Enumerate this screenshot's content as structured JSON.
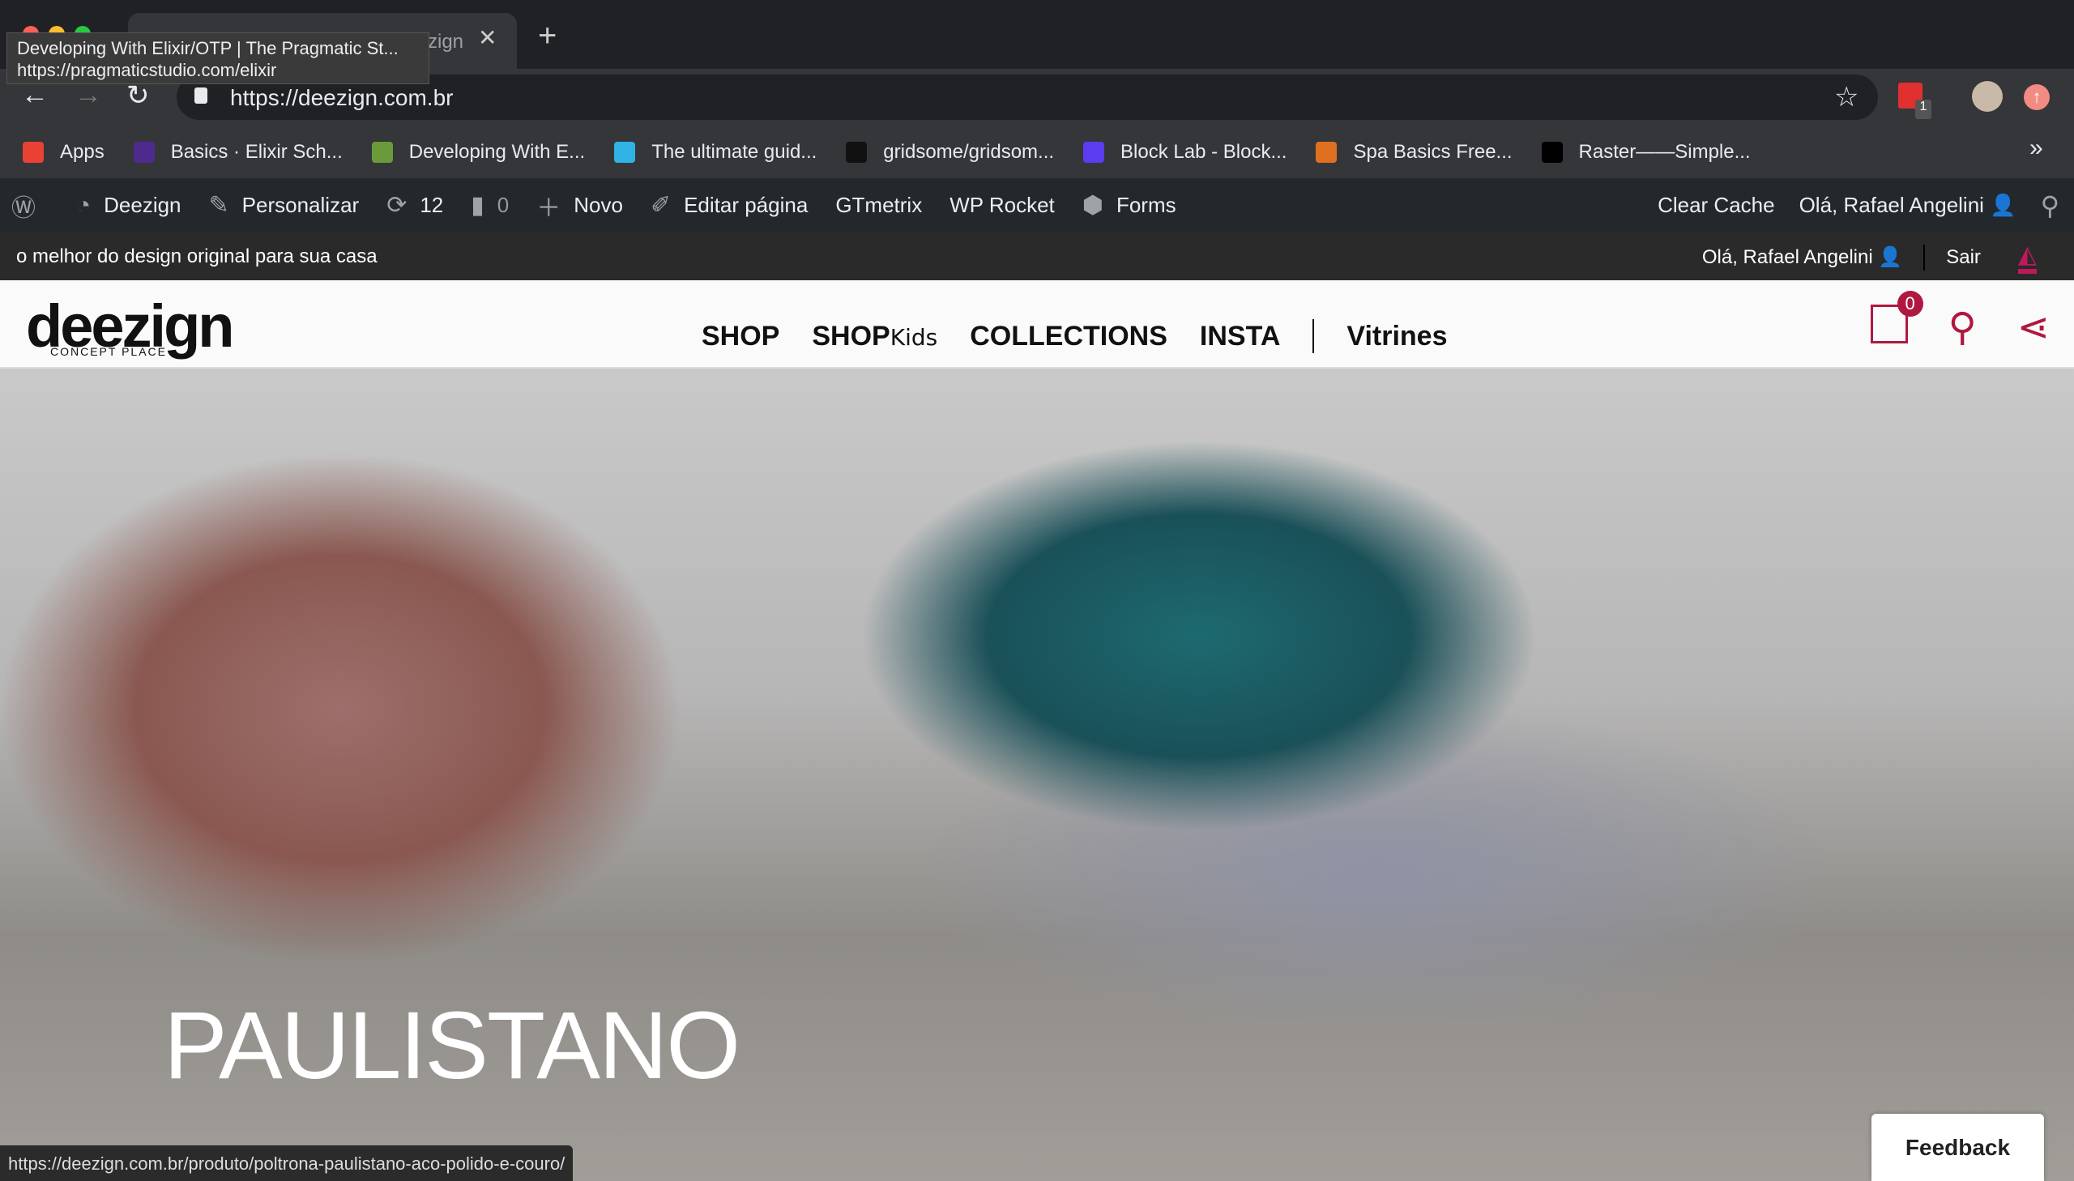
{
  "browser": {
    "tab_title": "Deezign",
    "tab_visible_fragment": "zign",
    "tooltip": {
      "title": "Developing With Elixir/OTP | The Pragmatic St...",
      "url": "https://pragmaticstudio.com/elixir"
    },
    "url": "https://deezign.com.br",
    "extension_badge": "1",
    "bookmarks": [
      {
        "label": "Apps",
        "icon": "apps-grid-icon",
        "color": "#e94235"
      },
      {
        "label": "Basics · Elixir Sch...",
        "icon": "elixir-icon",
        "color": "#4e2a8e"
      },
      {
        "label": "Developing With E...",
        "icon": "s-icon",
        "color": "#6a9a3a"
      },
      {
        "label": "The ultimate guid...",
        "icon": "bear-icon",
        "color": "#2fb3e6"
      },
      {
        "label": "gridsome/gridsom...",
        "icon": "github-icon",
        "color": "#111111"
      },
      {
        "label": "Block Lab - Block...",
        "icon": "blocklab-icon",
        "color": "#5b3cf0"
      },
      {
        "label": "Spa Basics Free...",
        "icon": "lotus-icon",
        "color": "#e07020"
      },
      {
        "label": "Raster——Simple...",
        "icon": "raster-icon",
        "color": "#000000"
      }
    ],
    "more": "»"
  },
  "wp_admin": {
    "site": "Deezign",
    "customize": "Personalizar",
    "updates": "12",
    "comments": "0",
    "new": "Novo",
    "edit": "Editar página",
    "gtmetrix": "GTmetrix",
    "wprocket": "WP Rocket",
    "forms": "Forms",
    "clear_cache": "Clear Cache",
    "greeting": "Olá, Rafael Angelini"
  },
  "topstrip": {
    "tagline": "o melhor do design original para sua casa",
    "greeting": "Olá, Rafael Angelini",
    "logout": "Sair"
  },
  "header": {
    "logo": "deezign",
    "logo_sub": "CONCEPT PLACE",
    "nav": [
      "SHOP",
      "SHOP",
      "COLLECTIONS",
      "INSTA",
      "Vitrines"
    ],
    "nav_kids": "Kids",
    "cart_count": "0",
    "accent": "#b0183f"
  },
  "hero": {
    "title": "PAULISTANO"
  },
  "status_url": "https://deezign.com.br/produto/poltrona-paulistano-aco-polido-e-couro/",
  "feedback": "Feedback"
}
